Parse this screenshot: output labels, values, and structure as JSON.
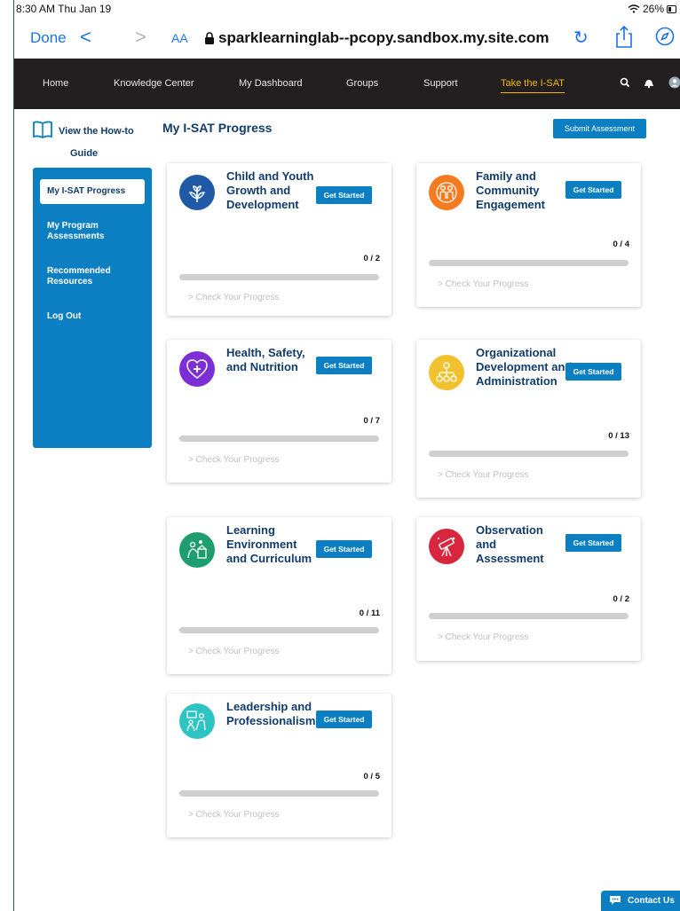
{
  "status_bar": {
    "time": "8:30 AM  Thu Jan 19",
    "battery": "26%"
  },
  "safari": {
    "done_label": "Done",
    "back_glyph": "<",
    "forward_glyph": ">",
    "aa_label": "AA",
    "url": "sparklearninglab--pcopy.sandbox.my.site.com",
    "icons": [
      "lock-icon",
      "reload-icon",
      "share-icon",
      "compass-icon"
    ]
  },
  "nav": {
    "items": [
      "Home",
      "Knowledge Center",
      "My Dashboard",
      "Groups",
      "Support",
      "Take the I-SAT"
    ],
    "active_item": "Take the I-SAT",
    "icons": [
      "search-icon",
      "bell-icon",
      "avatar-icon"
    ]
  },
  "howto": {
    "line1": "View the How-to",
    "line2": "Guide"
  },
  "sidebar": {
    "items": [
      "My I-SAT Progress",
      "My Program Assessments",
      "Recommended Resources",
      "Log Out"
    ],
    "active_item": "My I-SAT Progress"
  },
  "main": {
    "title": "My I-SAT Progress",
    "submit_label": "Submit Assessment"
  },
  "cards": [
    {
      "title": "Child and Youth Growth and Development",
      "button": "Get Started",
      "progress_text": "0 / 2",
      "progress": 0,
      "link": "> Check Your Progress",
      "icon": "sprout-icon",
      "color": "#1f5aa6"
    },
    {
      "title": "Family and Community Engagement",
      "button": "Get Started",
      "progress_text": "0 / 4",
      "progress": 0,
      "link": "> Check Your Progress",
      "icon": "family-icon",
      "color": "#f47b20"
    },
    {
      "title": "Health, Safety, and Nutrition",
      "button": "Get Started",
      "progress_text": "0 / 7",
      "progress": 0,
      "link": "> Check Your Progress",
      "icon": "heart-plus-icon",
      "color": "#7b2fd4"
    },
    {
      "title": "Organizational Development and Administration",
      "button": "Get Started",
      "progress_text": "0 / 13",
      "progress": 0,
      "link": "> Check Your Progress",
      "icon": "org-chart-icon",
      "color": "#f2c12e"
    },
    {
      "title": "Learning Environment and Curriculum",
      "button": "Get Started",
      "progress_text": "0 / 11",
      "progress": 0,
      "link": "> Check Your Progress",
      "icon": "learning-icon",
      "color": "#1e9e6e"
    },
    {
      "title": "Observation and Assessment",
      "button": "Get Started",
      "progress_text": "0 / 2",
      "progress": 0,
      "link": "> Check Your Progress",
      "icon": "telescope-icon",
      "color": "#d7263d"
    },
    {
      "title": "Leadership and Professionalism",
      "button": "Get Started",
      "progress_text": "0 / 5",
      "progress": 0,
      "link": "> Check Your Progress",
      "icon": "leadership-icon",
      "color": "#2ec4c4"
    }
  ],
  "contact": {
    "label": "Contact Us",
    "icon": "chat-icon"
  }
}
